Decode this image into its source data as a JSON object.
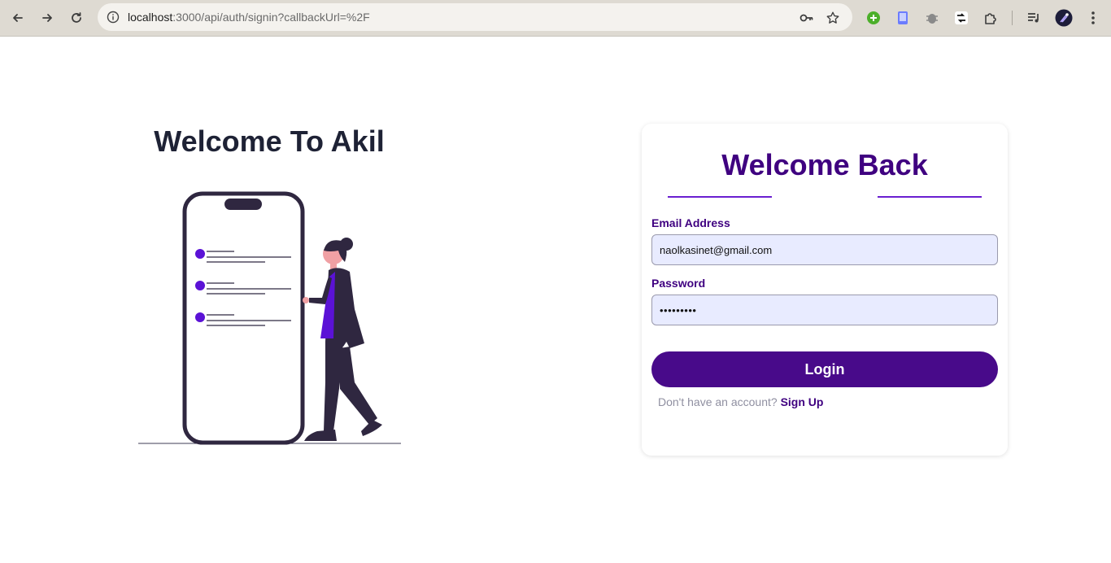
{
  "browser": {
    "url_host": "localhost",
    "url_path": ":3000/api/auth/signin?callbackUrl=%2F",
    "icons": [
      "back-icon",
      "forward-icon",
      "reload-icon",
      "site-info-icon",
      "password-key-icon",
      "bookmark-star-icon",
      "extension-icons",
      "extensions-puzzle-icon",
      "media-control-icon",
      "profile-avatar-icon",
      "menu-kebab-icon"
    ]
  },
  "hero": {
    "title": "Welcome To Akil"
  },
  "login": {
    "title": "Welcome Back",
    "email_label": "Email Address",
    "email_value": "naolkasinet@gmail.com",
    "password_label": "Password",
    "password_value": "•••••••••",
    "login_button": "Login",
    "signup_prompt": "Don't have an account?",
    "signup_link": "Sign Up"
  },
  "colors": {
    "brand": "#3f0080",
    "button": "#480a8a",
    "accent": "#5b12d6",
    "input_bg": "#e8ebff"
  }
}
